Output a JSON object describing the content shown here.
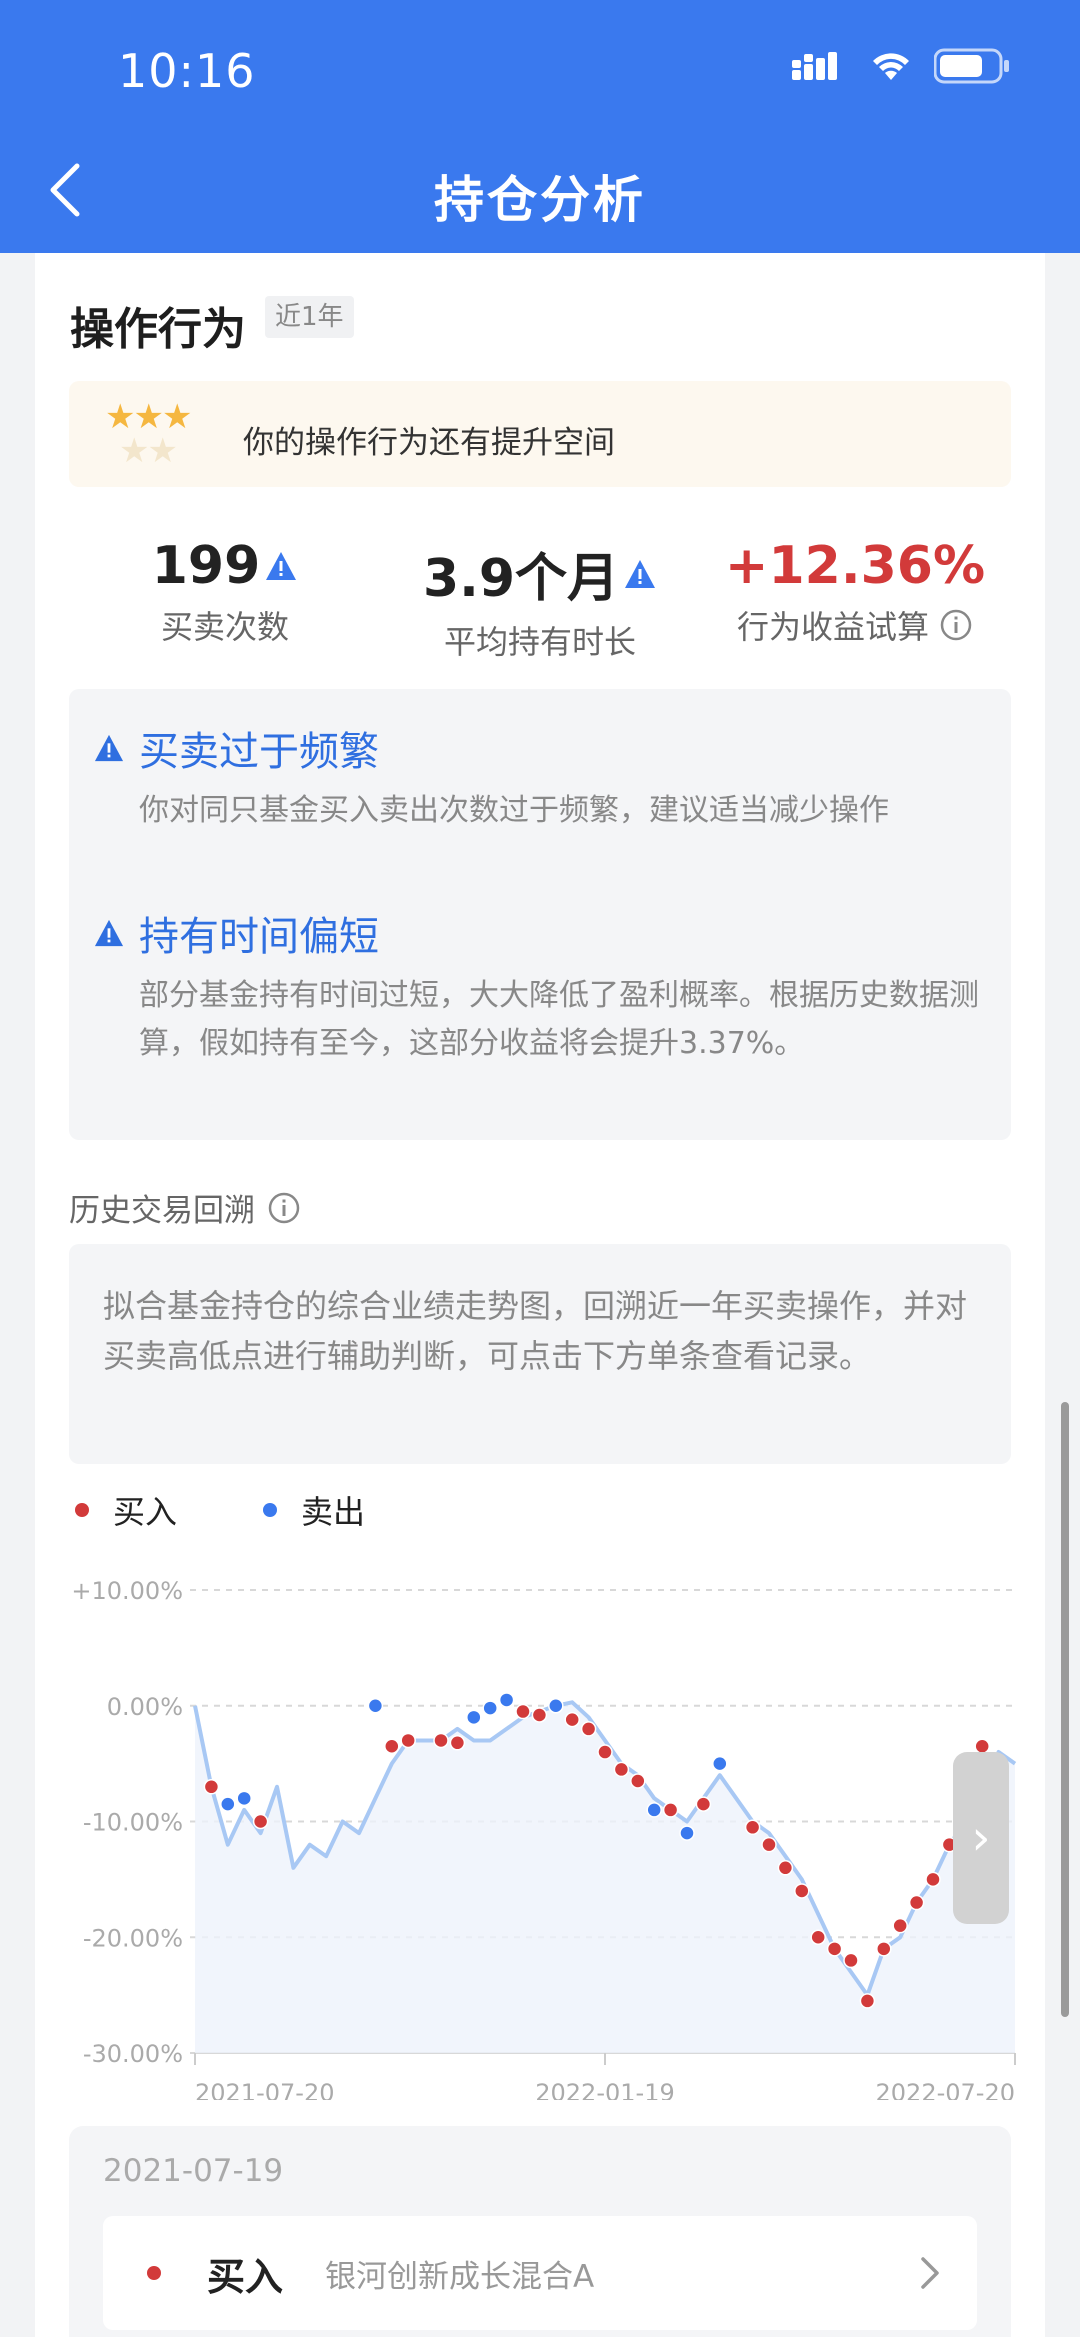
{
  "status": {
    "time": "10:16"
  },
  "nav": {
    "title": "持仓分析"
  },
  "section": {
    "title": "操作行为",
    "tag": "近1年"
  },
  "rating": {
    "stars_filled": "★★★",
    "stars_empty": "★★",
    "text": "你的操作行为还有提升空间"
  },
  "stats": [
    {
      "value": "199",
      "label": "买卖次数"
    },
    {
      "value": "3.9个月",
      "label": "平均持有时长"
    },
    {
      "value": "+12.36%",
      "label": "行为收益试算"
    }
  ],
  "warnings": [
    {
      "title": "买卖过于频繁",
      "desc": "你对同只基金买入卖出次数过于频繁，建议适当减少操作"
    },
    {
      "title": "持有时间偏短",
      "desc": "部分基金持有时间过短，大大降低了盈利概率。根据历史数据测算，假如持有至今，这部分收益将会提升3.37%。"
    }
  ],
  "history": {
    "title": "历史交易回溯",
    "desc": "拟合基金持仓的综合业绩走势图，回溯近一年买卖操作，并对买卖高低点进行辅助判断，可点击下方单条查看记录。"
  },
  "legend": [
    {
      "label": "买入",
      "color": "#d23a3a"
    },
    {
      "label": "卖出",
      "color": "#3a79ee"
    }
  ],
  "chart_data": {
    "type": "line",
    "y_tick_labels": [
      "+10.00%",
      "0.00%",
      "-10.00%",
      "-20.00%",
      "-30.00%"
    ],
    "x_tick_labels": [
      "2021-07-20",
      "2022-01-19",
      "2022-07-20"
    ],
    "ylim": [
      -30,
      10
    ],
    "grid": true,
    "x": [
      0,
      1,
      2,
      3,
      4,
      5,
      6,
      7,
      8,
      9,
      10,
      11,
      12,
      13,
      14,
      15,
      16,
      17,
      18,
      19,
      20,
      21,
      22,
      23,
      24,
      25,
      26,
      27,
      28,
      29,
      30,
      31,
      32,
      33,
      34,
      35,
      36,
      37,
      38,
      39,
      40,
      41,
      42,
      43,
      44,
      45,
      46,
      47,
      48,
      49,
      50
    ],
    "series": [
      {
        "values": [
          0,
          -7,
          -12,
          -9,
          -11,
          -7,
          -14,
          -12,
          -13,
          -10,
          -11,
          -8,
          -5,
          -3,
          -3,
          -3,
          -2,
          -3,
          -3,
          -2,
          -1,
          -0.5,
          0,
          0.3,
          -1,
          -3,
          -5,
          -6,
          -8,
          -9,
          -10,
          -8,
          -6,
          -8,
          -10,
          -11,
          -13,
          -15,
          -18,
          -21,
          -23,
          -25,
          -21,
          -20,
          -17,
          -15,
          -12,
          -10,
          -7,
          -4,
          -5
        ],
        "color": "#a8c8f4"
      }
    ],
    "markers_buy": [
      [
        1,
        -7
      ],
      [
        4,
        -10
      ],
      [
        12,
        -3.5
      ],
      [
        13,
        -3
      ],
      [
        15,
        -3
      ],
      [
        16,
        -3.2
      ],
      [
        20,
        -0.5
      ],
      [
        21,
        -0.8
      ],
      [
        23,
        -1.2
      ],
      [
        24,
        -2
      ],
      [
        25,
        -4
      ],
      [
        26,
        -5.5
      ],
      [
        27,
        -6.5
      ],
      [
        29,
        -9
      ],
      [
        31,
        -8.5
      ],
      [
        34,
        -10.5
      ],
      [
        35,
        -12
      ],
      [
        36,
        -14
      ],
      [
        37,
        -16
      ],
      [
        38,
        -20
      ],
      [
        39,
        -21
      ],
      [
        40,
        -22
      ],
      [
        41,
        -25.5
      ],
      [
        42,
        -21
      ],
      [
        43,
        -19
      ],
      [
        44,
        -17
      ],
      [
        45,
        -15
      ],
      [
        46,
        -12
      ],
      [
        48,
        -3.5
      ],
      [
        49,
        -5
      ]
    ],
    "markers_sell": [
      [
        2,
        -8.5
      ],
      [
        3,
        -8
      ],
      [
        11,
        0
      ],
      [
        17,
        -1
      ],
      [
        18,
        -0.2
      ],
      [
        19,
        0.5
      ],
      [
        22,
        0
      ],
      [
        28,
        -9
      ],
      [
        30,
        -11
      ],
      [
        32,
        -5
      ],
      [
        47,
        -10
      ],
      [
        48,
        -6
      ]
    ]
  },
  "chart_nav": "›",
  "day": {
    "date": "2021-07-19",
    "type": "买入",
    "fund": "银河创新成长混合A"
  }
}
